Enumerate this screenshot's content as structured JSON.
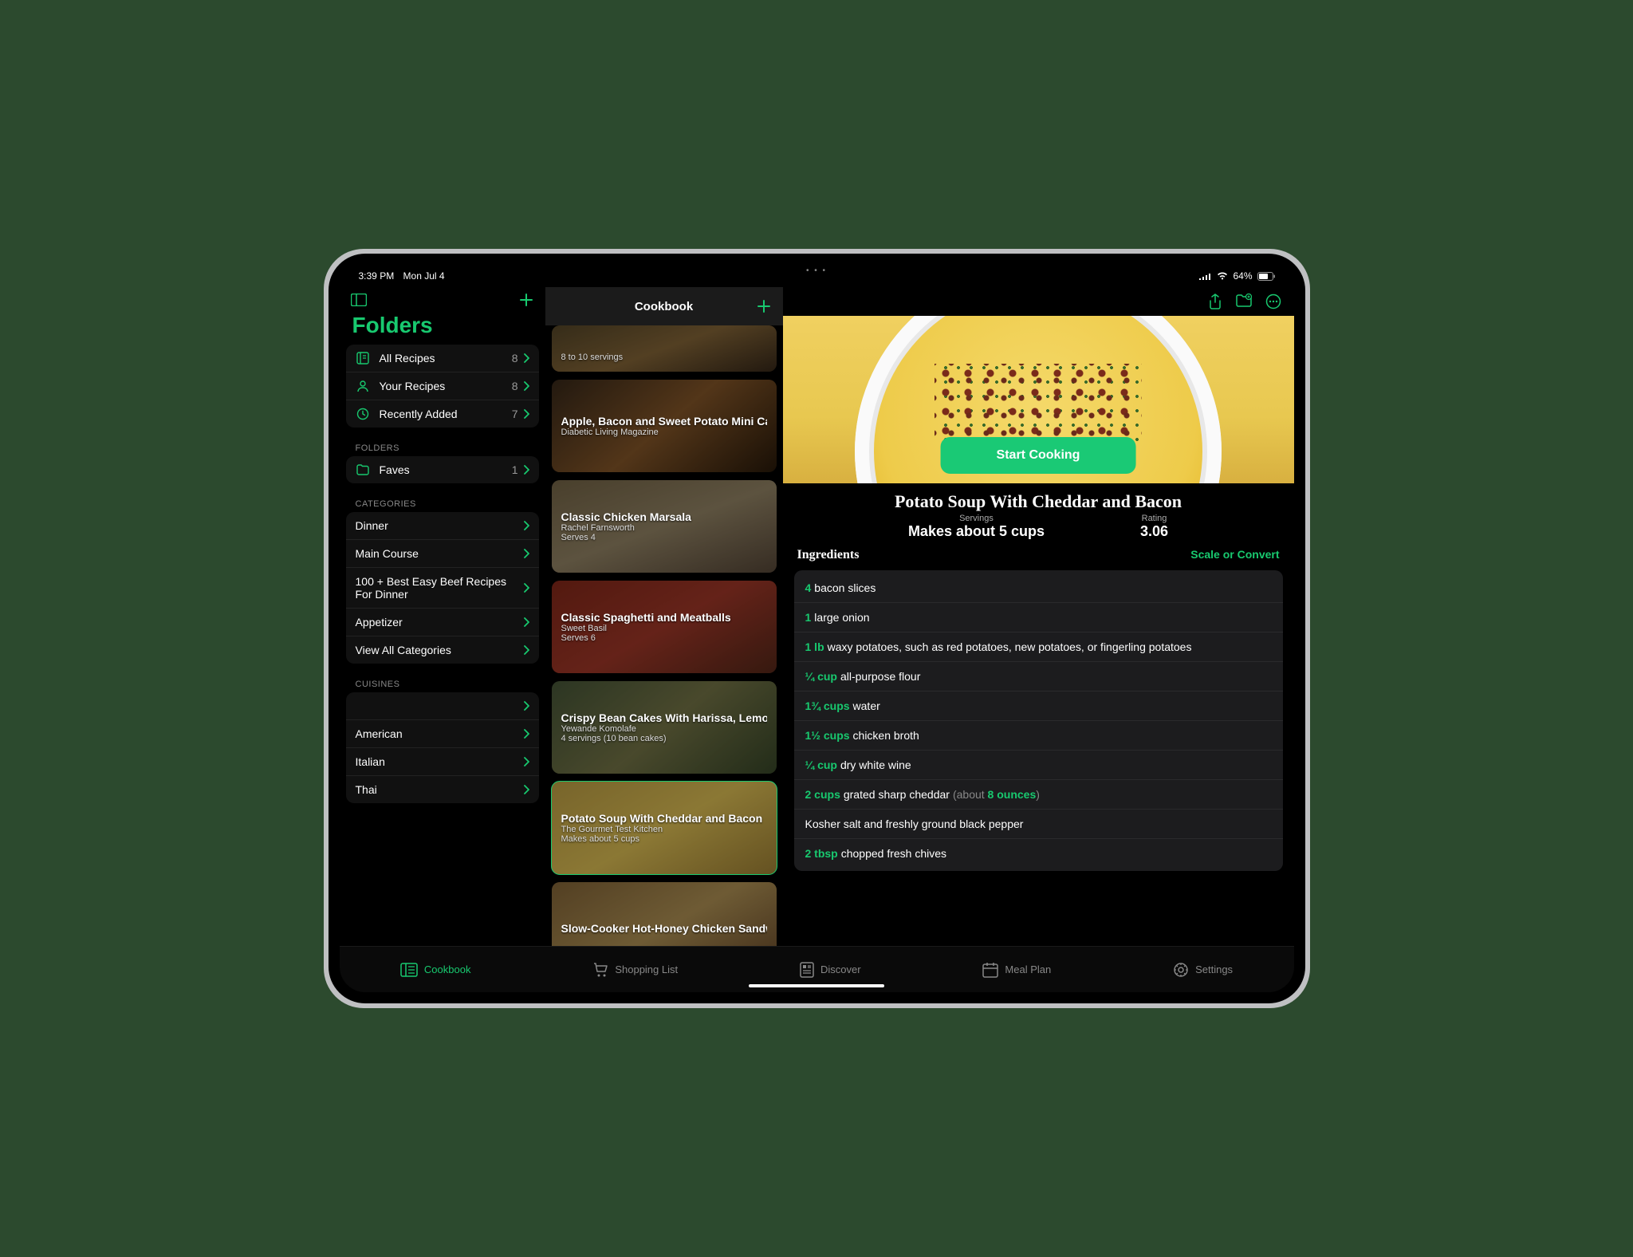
{
  "statusbar": {
    "time": "3:39 PM",
    "date": "Mon Jul 4",
    "battery_pct": "64%"
  },
  "sidebar": {
    "title": "Folders",
    "main_items": [
      {
        "icon": "book",
        "label": "All Recipes",
        "count": "8"
      },
      {
        "icon": "person",
        "label": "Your Recipes",
        "count": "8"
      },
      {
        "icon": "clock",
        "label": "Recently Added",
        "count": "7"
      }
    ],
    "folders_header": "FOLDERS",
    "folder_items": [
      {
        "icon": "folder",
        "label": "Faves",
        "count": "1"
      }
    ],
    "categories_header": "CATEGORIES",
    "category_items": [
      {
        "label": "Dinner"
      },
      {
        "label": "Main Course"
      },
      {
        "label": "100 + Best Easy Beef Recipes For Dinner"
      },
      {
        "label": "Appetizer"
      }
    ],
    "view_all_categories": "View All Categories",
    "cuisines_header": "CUISINES",
    "cuisine_items": [
      {
        "label": ""
      },
      {
        "label": "American"
      },
      {
        "label": "Italian"
      },
      {
        "label": "Thai"
      }
    ]
  },
  "recipe_list": {
    "header": "Cookbook",
    "items": [
      {
        "title": "",
        "subtitle": "",
        "servings": "8 to 10 servings",
        "bg": "linear-gradient(160deg,#5a4a2a,#8a6a3a,#3a2a1a)"
      },
      {
        "title": "Apple, Bacon and Sweet Potato Mini Casse",
        "subtitle": "Diabetic Living Magazine",
        "servings": "",
        "bg": "linear-gradient(140deg,#3a2a1a,#8a5a2a,#2a1a0a)"
      },
      {
        "title": "Classic Chicken Marsala",
        "subtitle": "Rachel Farnsworth",
        "servings": "Serves 4",
        "bg": "linear-gradient(160deg,#7a6a4a,#9a8a6a,#5a4a3a)"
      },
      {
        "title": "Classic Spaghetti and Meatballs",
        "subtitle": "Sweet Basil",
        "servings": "Serves 6",
        "bg": "linear-gradient(150deg,#8a2a1a,#a83a2a,#5a2a1a)"
      },
      {
        "title": "Crispy Bean Cakes With Harissa, Lemon an",
        "subtitle": "Yewande Komolafe",
        "servings": "4 servings (10 bean cakes)",
        "bg": "linear-gradient(140deg,#4a5a3a,#7a7a4a,#3a4a2a)"
      },
      {
        "title": "Potato Soup With Cheddar and Bacon",
        "subtitle": "The Gourmet Test Kitchen",
        "servings": "Makes about 5 cups",
        "bg": "linear-gradient(150deg,#c8a848,#e8c858,#a88838)",
        "selected": true
      },
      {
        "title": "Slow-Cooker Hot-Honey Chicken Sandwich",
        "subtitle": "",
        "servings": "",
        "bg": "linear-gradient(150deg,#8a6a3a,#b89858,#6a4a2a)"
      }
    ]
  },
  "detail": {
    "start_cooking": "Start Cooking",
    "title": "Potato Soup With Cheddar and Bacon",
    "servings_label": "Servings",
    "servings_value": "Makes about 5 cups",
    "rating_label": "Rating",
    "rating_value": "3.06",
    "ingredients_header": "Ingredients",
    "scale_convert": "Scale or Convert",
    "ingredients": [
      {
        "amount": "4",
        "text": "bacon slices"
      },
      {
        "amount": "1",
        "text": "large onion"
      },
      {
        "amount": "1 lb",
        "text": "waxy potatoes, such as red potatoes, new potatoes, or fingerling potatoes"
      },
      {
        "amount": "¼ cup",
        "text": "all-purpose flour"
      },
      {
        "amount": "1¾ cups",
        "text": "water"
      },
      {
        "amount": "1½ cups",
        "text": "chicken broth"
      },
      {
        "amount": "¼ cup",
        "text": "dry white wine"
      },
      {
        "amount": "2 cups",
        "text": "grated sharp cheddar",
        "hint_prefix": "(about ",
        "hint_amount": "8 ounces",
        "hint_suffix": ")"
      },
      {
        "amount": "",
        "text": "Kosher salt and freshly ground black pepper"
      },
      {
        "amount": "2 tbsp",
        "text": "chopped fresh chives"
      }
    ]
  },
  "tabbar": {
    "items": [
      {
        "label": "Cookbook",
        "active": true
      },
      {
        "label": "Shopping List"
      },
      {
        "label": "Discover"
      },
      {
        "label": "Meal Plan"
      },
      {
        "label": "Settings"
      }
    ]
  }
}
